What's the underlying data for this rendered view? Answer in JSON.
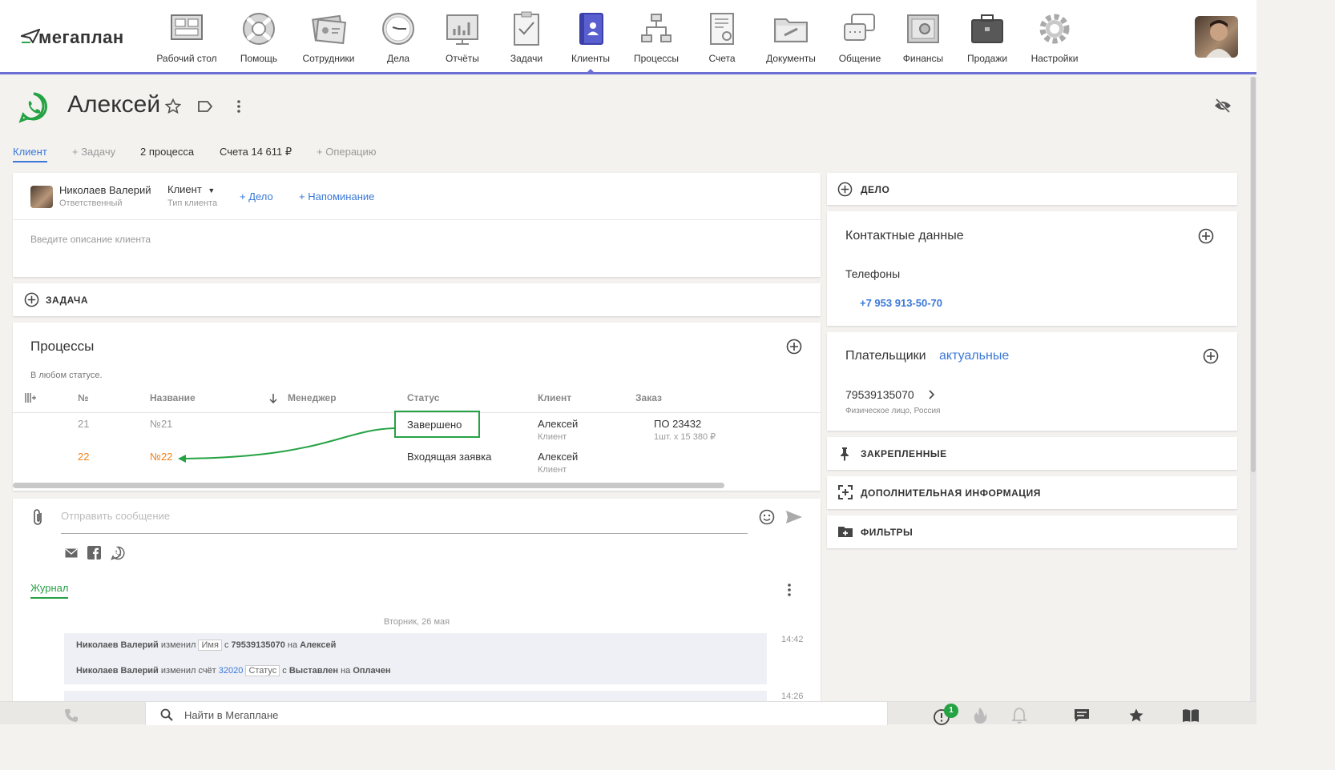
{
  "app": {
    "logo": "мегаплан"
  },
  "nav": [
    {
      "id": "desk",
      "label": "Рабочий стол",
      "icon": "desktop-icon"
    },
    {
      "id": "help",
      "label": "Помощь",
      "icon": "lifebuoy-icon"
    },
    {
      "id": "staff",
      "label": "Сотрудники",
      "icon": "staff-card-icon"
    },
    {
      "id": "affairs",
      "label": "Дела",
      "icon": "clock-icon"
    },
    {
      "id": "reports",
      "label": "Отчёты",
      "icon": "chart-board-icon"
    },
    {
      "id": "tasks",
      "label": "Задачи",
      "icon": "clipboard-icon"
    },
    {
      "id": "clients",
      "label": "Клиенты",
      "icon": "contacts-book-icon",
      "active": true
    },
    {
      "id": "processes",
      "label": "Процессы",
      "icon": "flowchart-icon"
    },
    {
      "id": "invoices",
      "label": "Счета",
      "icon": "invoice-icon"
    },
    {
      "id": "documents",
      "label": "Документы",
      "icon": "folder-icon"
    },
    {
      "id": "chat",
      "label": "Общение",
      "icon": "chat-bubbles-icon"
    },
    {
      "id": "finance",
      "label": "Финансы",
      "icon": "safe-icon"
    },
    {
      "id": "sales",
      "label": "Продажи",
      "icon": "briefcase-icon"
    },
    {
      "id": "settings",
      "label": "Настройки",
      "icon": "gear-icon"
    }
  ],
  "client": {
    "name": "Алексей",
    "tabs": {
      "client": "Клиент",
      "task": "+ Задачу",
      "processes": "2 процесса",
      "invoices": "Счета 14 611 ₽",
      "operation": "+ Операцию"
    },
    "responsible": {
      "name": "Николаев Валерий",
      "role": "Ответственный"
    },
    "type": {
      "value": "Клиент",
      "label": "Тип клиента"
    },
    "add_affair": "+ Дело",
    "add_reminder": "+ Напоминание",
    "description_placeholder": "Введите описание клиента"
  },
  "task_section": "ЗАДАЧА",
  "processes": {
    "title": "Процессы",
    "filter": "В любом статусе.",
    "columns": {
      "num": "№",
      "name": "Название",
      "manager": "Менеджер",
      "status": "Статус",
      "client": "Клиент",
      "order": "Заказ"
    },
    "rows": [
      {
        "num": "21",
        "name": "№21",
        "status": "Завершено",
        "client": "Алексей",
        "client_sub": "Клиент",
        "order": "ПО 23432",
        "order_sub": "1шт. х 15 380 ₽"
      },
      {
        "num": "22",
        "name": "№22",
        "status": "Входящая заявка",
        "client": "Алексей",
        "client_sub": "Клиент",
        "order": "",
        "order_sub": ""
      }
    ]
  },
  "message": {
    "placeholder": "Отправить сообщение"
  },
  "journal": {
    "tab": "Журнал",
    "date": "Вторник, 26 мая",
    "entries": [
      {
        "time": "14:42",
        "lines": [
          {
            "user": "Николаев Валерий",
            "action": "изменил",
            "field": "Имя",
            "from_word": "с",
            "from": "79539135070",
            "to_word": "на",
            "to": "Алексей"
          },
          {
            "user": "Николаев Валерий",
            "action": "изменил счёт",
            "link": "32020",
            "field": "Статус",
            "from_word": "с",
            "from": "Выставлен",
            "to_word": "на",
            "to": "Оплачен"
          }
        ]
      },
      {
        "time": "14:26",
        "lines": []
      }
    ]
  },
  "right": {
    "affair": "ДЕЛО",
    "contacts_title": "Контактные данные",
    "phones_label": "Телефоны",
    "phone": "+7 953 913-50-70",
    "payers_title": "Плательщики",
    "payers_filter": "актуальные",
    "payer": {
      "name": "79539135070",
      "sub": "Физическое лицо, Россия"
    },
    "pinned": "ЗАКРЕПЛЕННЫЕ",
    "extra": "ДОПОЛНИТЕЛЬНАЯ ИНФОРМАЦИЯ",
    "filters": "ФИЛЬТРЫ"
  },
  "bottom": {
    "search_placeholder": "Найти в Мегаплане",
    "notifications_count": "1"
  },
  "colors": {
    "accent": "#6b6fd4",
    "link": "#3b78d8",
    "green": "#25a244",
    "orange": "#f0801a"
  }
}
